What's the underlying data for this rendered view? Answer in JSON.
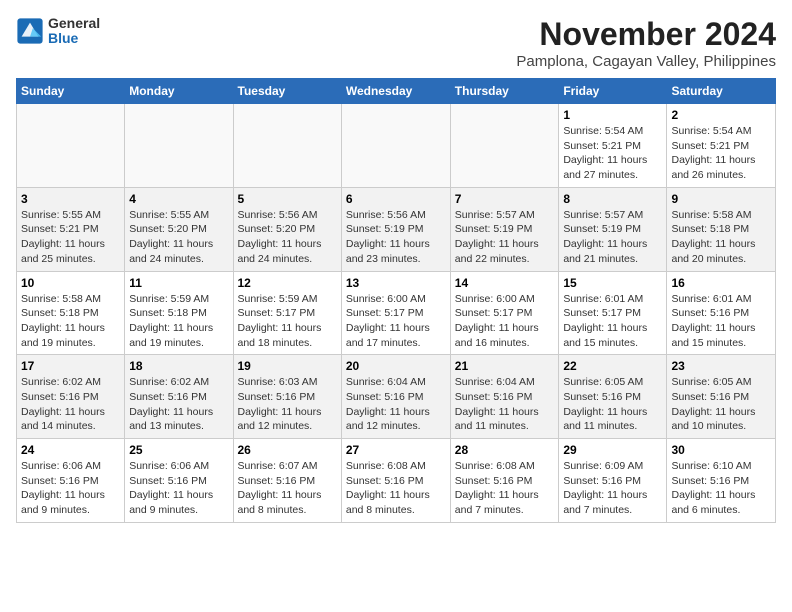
{
  "logo": {
    "general": "General",
    "blue": "Blue"
  },
  "title": "November 2024",
  "location": "Pamplona, Cagayan Valley, Philippines",
  "days_of_week": [
    "Sunday",
    "Monday",
    "Tuesday",
    "Wednesday",
    "Thursday",
    "Friday",
    "Saturday"
  ],
  "weeks": [
    [
      {
        "day": "",
        "info": ""
      },
      {
        "day": "",
        "info": ""
      },
      {
        "day": "",
        "info": ""
      },
      {
        "day": "",
        "info": ""
      },
      {
        "day": "",
        "info": ""
      },
      {
        "day": "1",
        "info": "Sunrise: 5:54 AM\nSunset: 5:21 PM\nDaylight: 11 hours\nand 27 minutes."
      },
      {
        "day": "2",
        "info": "Sunrise: 5:54 AM\nSunset: 5:21 PM\nDaylight: 11 hours\nand 26 minutes."
      }
    ],
    [
      {
        "day": "3",
        "info": "Sunrise: 5:55 AM\nSunset: 5:21 PM\nDaylight: 11 hours\nand 25 minutes."
      },
      {
        "day": "4",
        "info": "Sunrise: 5:55 AM\nSunset: 5:20 PM\nDaylight: 11 hours\nand 24 minutes."
      },
      {
        "day": "5",
        "info": "Sunrise: 5:56 AM\nSunset: 5:20 PM\nDaylight: 11 hours\nand 24 minutes."
      },
      {
        "day": "6",
        "info": "Sunrise: 5:56 AM\nSunset: 5:19 PM\nDaylight: 11 hours\nand 23 minutes."
      },
      {
        "day": "7",
        "info": "Sunrise: 5:57 AM\nSunset: 5:19 PM\nDaylight: 11 hours\nand 22 minutes."
      },
      {
        "day": "8",
        "info": "Sunrise: 5:57 AM\nSunset: 5:19 PM\nDaylight: 11 hours\nand 21 minutes."
      },
      {
        "day": "9",
        "info": "Sunrise: 5:58 AM\nSunset: 5:18 PM\nDaylight: 11 hours\nand 20 minutes."
      }
    ],
    [
      {
        "day": "10",
        "info": "Sunrise: 5:58 AM\nSunset: 5:18 PM\nDaylight: 11 hours\nand 19 minutes."
      },
      {
        "day": "11",
        "info": "Sunrise: 5:59 AM\nSunset: 5:18 PM\nDaylight: 11 hours\nand 19 minutes."
      },
      {
        "day": "12",
        "info": "Sunrise: 5:59 AM\nSunset: 5:17 PM\nDaylight: 11 hours\nand 18 minutes."
      },
      {
        "day": "13",
        "info": "Sunrise: 6:00 AM\nSunset: 5:17 PM\nDaylight: 11 hours\nand 17 minutes."
      },
      {
        "day": "14",
        "info": "Sunrise: 6:00 AM\nSunset: 5:17 PM\nDaylight: 11 hours\nand 16 minutes."
      },
      {
        "day": "15",
        "info": "Sunrise: 6:01 AM\nSunset: 5:17 PM\nDaylight: 11 hours\nand 15 minutes."
      },
      {
        "day": "16",
        "info": "Sunrise: 6:01 AM\nSunset: 5:16 PM\nDaylight: 11 hours\nand 15 minutes."
      }
    ],
    [
      {
        "day": "17",
        "info": "Sunrise: 6:02 AM\nSunset: 5:16 PM\nDaylight: 11 hours\nand 14 minutes."
      },
      {
        "day": "18",
        "info": "Sunrise: 6:02 AM\nSunset: 5:16 PM\nDaylight: 11 hours\nand 13 minutes."
      },
      {
        "day": "19",
        "info": "Sunrise: 6:03 AM\nSunset: 5:16 PM\nDaylight: 11 hours\nand 12 minutes."
      },
      {
        "day": "20",
        "info": "Sunrise: 6:04 AM\nSunset: 5:16 PM\nDaylight: 11 hours\nand 12 minutes."
      },
      {
        "day": "21",
        "info": "Sunrise: 6:04 AM\nSunset: 5:16 PM\nDaylight: 11 hours\nand 11 minutes."
      },
      {
        "day": "22",
        "info": "Sunrise: 6:05 AM\nSunset: 5:16 PM\nDaylight: 11 hours\nand 11 minutes."
      },
      {
        "day": "23",
        "info": "Sunrise: 6:05 AM\nSunset: 5:16 PM\nDaylight: 11 hours\nand 10 minutes."
      }
    ],
    [
      {
        "day": "24",
        "info": "Sunrise: 6:06 AM\nSunset: 5:16 PM\nDaylight: 11 hours\nand 9 minutes."
      },
      {
        "day": "25",
        "info": "Sunrise: 6:06 AM\nSunset: 5:16 PM\nDaylight: 11 hours\nand 9 minutes."
      },
      {
        "day": "26",
        "info": "Sunrise: 6:07 AM\nSunset: 5:16 PM\nDaylight: 11 hours\nand 8 minutes."
      },
      {
        "day": "27",
        "info": "Sunrise: 6:08 AM\nSunset: 5:16 PM\nDaylight: 11 hours\nand 8 minutes."
      },
      {
        "day": "28",
        "info": "Sunrise: 6:08 AM\nSunset: 5:16 PM\nDaylight: 11 hours\nand 7 minutes."
      },
      {
        "day": "29",
        "info": "Sunrise: 6:09 AM\nSunset: 5:16 PM\nDaylight: 11 hours\nand 7 minutes."
      },
      {
        "day": "30",
        "info": "Sunrise: 6:10 AM\nSunset: 5:16 PM\nDaylight: 11 hours\nand 6 minutes."
      }
    ]
  ]
}
